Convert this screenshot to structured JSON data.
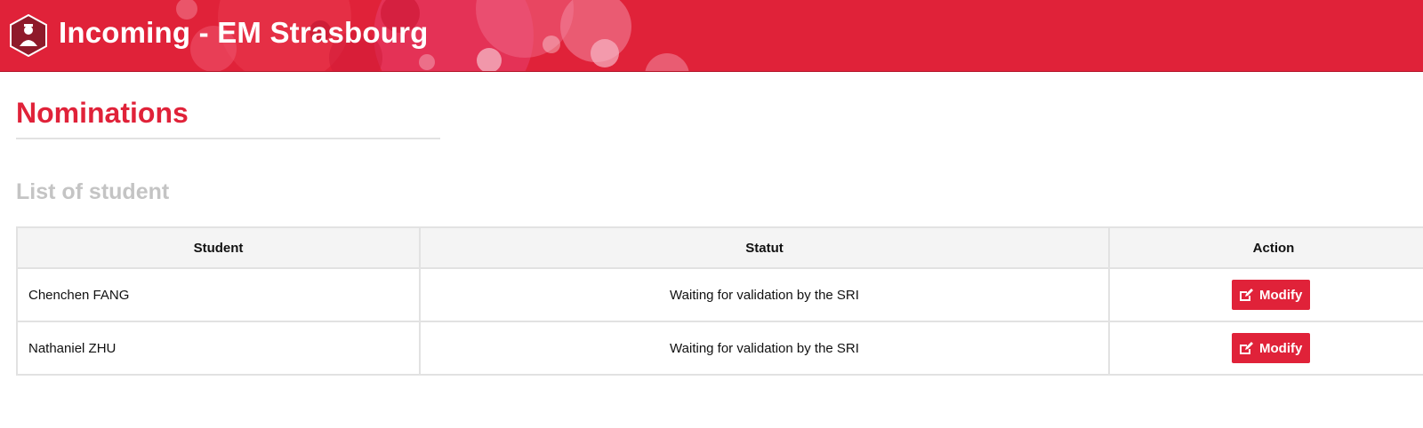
{
  "header": {
    "title": "Incoming - EM Strasbourg",
    "brand_color": "#e02239",
    "logo_icon": "school-logo-icon"
  },
  "page": {
    "title": "Nominations",
    "section_title": "List of student"
  },
  "table": {
    "columns": [
      "Student",
      "Statut",
      "Action"
    ],
    "rows": [
      {
        "student": "Chenchen FANG",
        "statut": "Waiting for validation by the SRI",
        "action": "Modify"
      },
      {
        "student": "Nathaniel ZHU",
        "statut": "Waiting for validation by the SRI",
        "action": "Modify"
      }
    ],
    "action_icon": "edit-icon"
  }
}
